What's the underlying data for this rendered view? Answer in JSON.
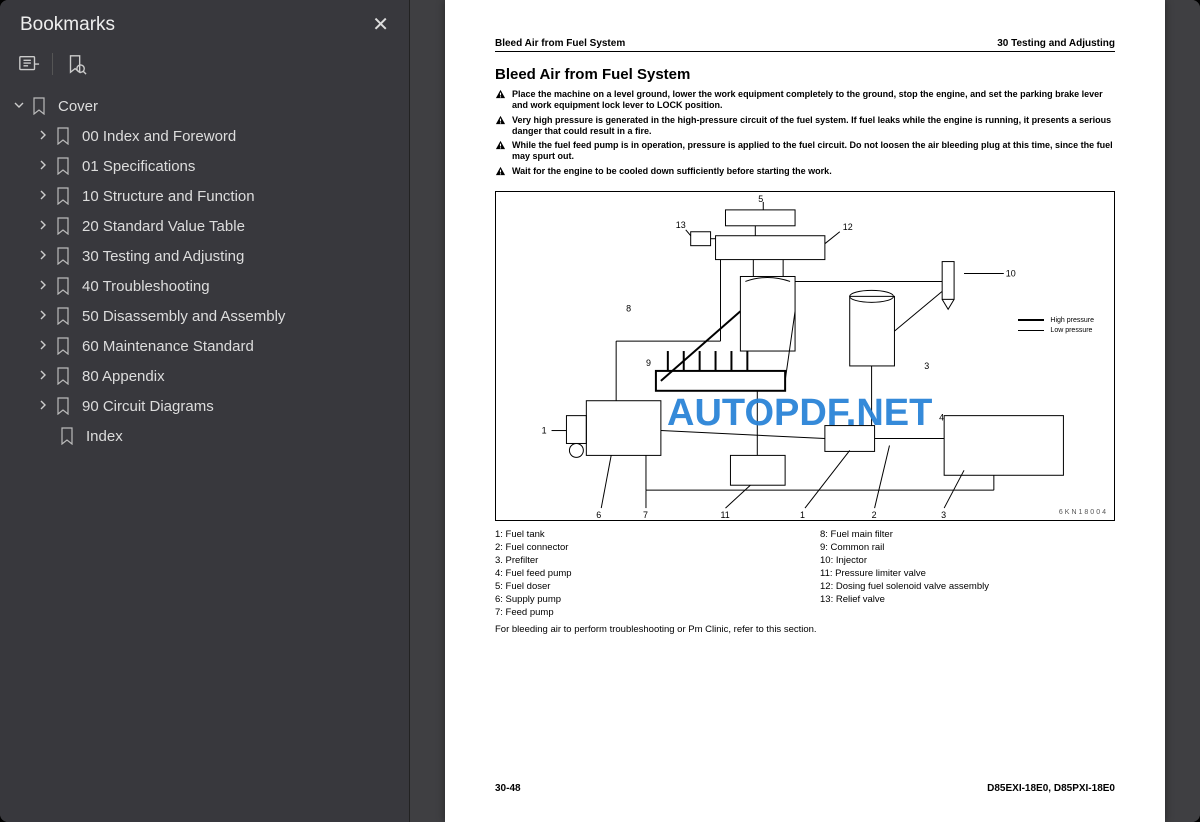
{
  "sidebar": {
    "title": "Bookmarks",
    "root": {
      "label": "Cover",
      "expanded": true
    },
    "items": [
      {
        "label": "00 Index and Foreword"
      },
      {
        "label": "01 Specifications"
      },
      {
        "label": "10 Structure and Function"
      },
      {
        "label": "20 Standard Value Table"
      },
      {
        "label": "30 Testing and Adjusting"
      },
      {
        "label": "40 Troubleshooting"
      },
      {
        "label": "50 Disassembly and Assembly"
      },
      {
        "label": "60 Maintenance Standard"
      },
      {
        "label": "80 Appendix"
      },
      {
        "label": "90 Circuit Diagrams"
      }
    ],
    "leaf": {
      "label": "Index"
    }
  },
  "doc": {
    "header_left": "Bleed Air from Fuel System",
    "header_right": "30 Testing and Adjusting",
    "title": "Bleed Air from Fuel System",
    "warnings": [
      "Place the machine on a level ground, lower the work equipment completely to the ground, stop the engine, and set the parking brake lever and work equipment lock lever to LOCK position.",
      "Very high pressure is generated in the high-pressure circuit of the fuel system. If fuel leaks while the engine is running, it presents a serious danger that could result in a fire.",
      "While the fuel feed pump is in operation, pressure is applied to the fuel circuit. Do not loosen the air bleeding plug at this time, since the fuel may spurt out.",
      "Wait for the engine to be cooled down sufficiently before starting the work."
    ],
    "diagram_legend": {
      "high": "High pressure",
      "low": "Low pressure"
    },
    "diagram_id": "6KN18004",
    "parts_left": [
      "1: Fuel tank",
      "2: Fuel connector",
      "3. Prefilter",
      "4: Fuel feed pump",
      "5: Fuel doser",
      "6: Supply pump",
      "7: Feed pump"
    ],
    "parts_right": [
      "8: Fuel main filter",
      "9: Common rail",
      "10: Injector",
      "11: Pressure limiter valve",
      "12: Dosing fuel solenoid valve assembly",
      "13: Relief valve"
    ],
    "note": "For bleeding air to perform troubleshooting or Pm Clinic, refer to this section.",
    "footer_left": "30-48",
    "footer_right": "D85EXI-18E0, D85PXI-18E0"
  },
  "watermark": "AUTOPDF.NET"
}
